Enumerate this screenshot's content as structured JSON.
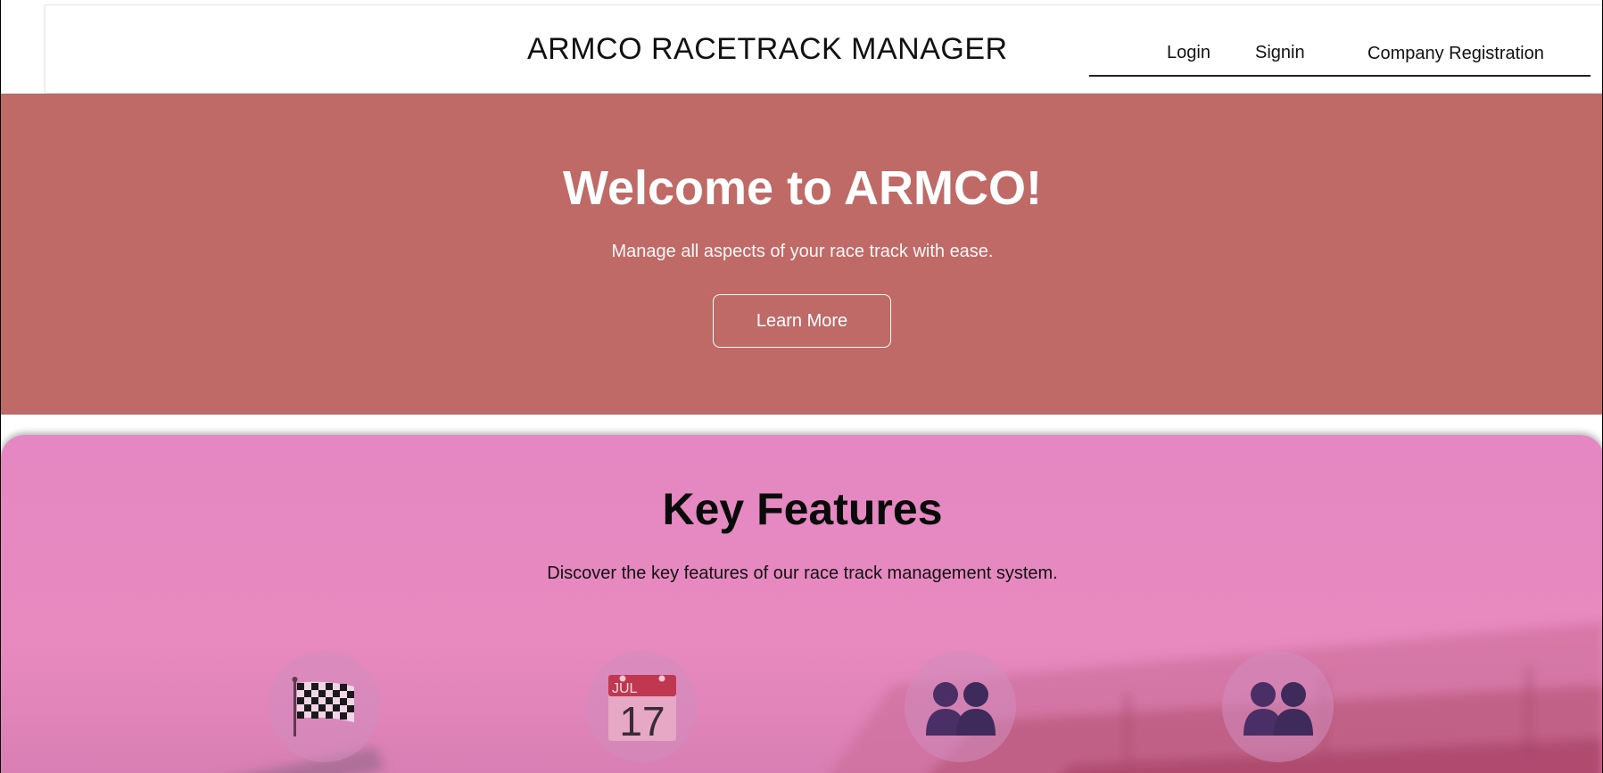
{
  "header": {
    "brand": "ARMCO RACETRACK MANAGER",
    "nav": {
      "login": "Login",
      "signin": "Signin",
      "company_registration": "Company Registration"
    }
  },
  "hero": {
    "title": "Welcome to ARMCO!",
    "subtitle": "Manage all aspects of your race track with ease.",
    "cta_label": "Learn More",
    "background": "#c06a68"
  },
  "features": {
    "title": "Key Features",
    "subtitle": "Discover the key features of our race track management system.",
    "items": [
      {
        "icon": "checkered-flag-icon"
      },
      {
        "icon": "calendar-icon",
        "month": "JUL",
        "day": "17"
      },
      {
        "icon": "people-icon"
      },
      {
        "icon": "people-icon"
      }
    ]
  }
}
